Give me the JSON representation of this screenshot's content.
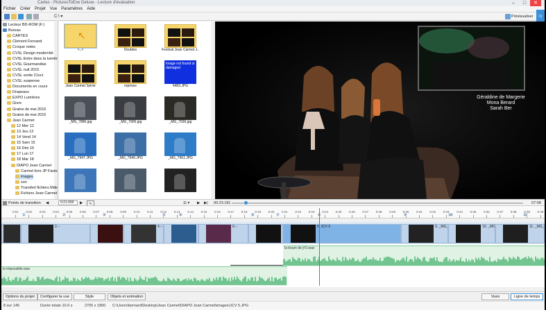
{
  "window": {
    "title": "Cartes - PicturesToExe Deluxe - Lecture d'évaluation"
  },
  "menu": [
    "Fichier",
    "Créer",
    "Projet",
    "Vue",
    "Paramètres",
    "Aide"
  ],
  "toolbar": {
    "drive_label": "C:\\",
    "preview_label": "Prévisualiser"
  },
  "folder_tree": [
    {
      "label": "Lecteur BD-ROM (F:)",
      "icon": "drive-icon",
      "indent": 0
    },
    {
      "label": "Bureau",
      "icon": "desktop-icon",
      "indent": 0
    },
    {
      "label": "CARTES",
      "icon": "folder-icon",
      "indent": 1
    },
    {
      "label": "Clemont Fernand",
      "icon": "folder-icon",
      "indent": 1
    },
    {
      "label": "Croque notes",
      "icon": "folder-icon",
      "indent": 1
    },
    {
      "label": "CVSL Design modernité",
      "icon": "folder-icon",
      "indent": 1
    },
    {
      "label": "CVSL Entre dans la lumière",
      "icon": "folder-icon",
      "indent": 1
    },
    {
      "label": "CVSL Gourmandise",
      "icon": "folder-icon",
      "indent": 1
    },
    {
      "label": "CVSL nuit 2015",
      "icon": "folder-icon",
      "indent": 1
    },
    {
      "label": "CVSL sortie 21oct",
      "icon": "folder-icon",
      "indent": 1
    },
    {
      "label": "CVSL suspense",
      "icon": "folder-icon",
      "indent": 1
    },
    {
      "label": "Documents en cours",
      "icon": "folder-icon",
      "indent": 1
    },
    {
      "label": "Drapeaux",
      "icon": "folder-icon",
      "indent": 1
    },
    {
      "label": "EXPO Lumières",
      "icon": "folder-icon",
      "indent": 1
    },
    {
      "label": "Givre",
      "icon": "folder-icon",
      "indent": 1
    },
    {
      "label": "Graine de mai 2016",
      "icon": "folder-icon",
      "indent": 1
    },
    {
      "label": "Graine de mai 2015",
      "icon": "folder-icon",
      "indent": 1
    },
    {
      "label": "Jean Carmet",
      "icon": "folder-icon",
      "indent": 1
    },
    {
      "label": "12 Mer 12",
      "icon": "folder-icon",
      "indent": 2
    },
    {
      "label": "13 Jeu 13",
      "icon": "folder-icon",
      "indent": 2
    },
    {
      "label": "14 Vend 14",
      "icon": "folder-icon",
      "indent": 2
    },
    {
      "label": "15 Sam 15",
      "icon": "folder-icon",
      "indent": 2
    },
    {
      "label": "16 Dim 16",
      "icon": "folder-icon",
      "indent": 2
    },
    {
      "label": "17 Lun 17",
      "icon": "folder-icon",
      "indent": 2
    },
    {
      "label": "18 Mar 18",
      "icon": "folder-icon",
      "indent": 2
    },
    {
      "label": "DIAPO Jean Carmet",
      "icon": "folder-icon",
      "indent": 2
    },
    {
      "label": "Carmet livre JP Favier",
      "icon": "folder-icon",
      "indent": 3
    },
    {
      "label": "images",
      "icon": "folder-icon",
      "indent": 3,
      "selected": true
    },
    {
      "label": "son",
      "icon": "folder-icon",
      "indent": 3
    },
    {
      "label": "Transfert fichiers Mdef",
      "icon": "folder-icon",
      "indent": 3
    },
    {
      "label": "Fichiers Jean Carmet 2016",
      "icon": "folder-icon",
      "indent": 3
    }
  ],
  "thumbnails": [
    {
      "label": "<..>",
      "kind": "up-folder"
    },
    {
      "label": "Doubles",
      "kind": "folder"
    },
    {
      "label": "Festival Jean Carmet J...",
      "kind": "folder"
    },
    {
      "label": "Jean Carmet Sylvie",
      "kind": "folder"
    },
    {
      "label": "reprises",
      "kind": "folder"
    },
    {
      "label": "6483.JPG",
      "kind": "broken",
      "broken_text": "Image not found or damaged"
    },
    {
      "label": "_MG_7886.jpg",
      "kind": "photo",
      "tint": "#4a4f58"
    },
    {
      "label": "_MG_7905.jpg",
      "kind": "photo",
      "tint": "#3a3d42"
    },
    {
      "label": "_MG_7939.jpg",
      "kind": "photo",
      "tint": "#2c2a24"
    },
    {
      "label": "_MG_7947.JPG",
      "kind": "photo",
      "tint": "#2a6fbf"
    },
    {
      "label": "_MG_7949.JPG",
      "kind": "photo",
      "tint": "#3c6fa6"
    },
    {
      "label": "_MG_7961.JPG",
      "kind": "photo",
      "tint": "#2e7bc7"
    },
    {
      "label": "",
      "kind": "photo",
      "tint": "#3d76b8"
    },
    {
      "label": "",
      "kind": "photo",
      "tint": "#4a5a68"
    },
    {
      "label": "",
      "kind": "photo",
      "tint": "#222"
    }
  ],
  "viewer": {
    "caption": [
      "Géraldine de Margerie",
      "Mona Berard",
      "Sarah Ber"
    ]
  },
  "transport": {
    "transition_points_label": "Points de transition",
    "transition_time": "0:21.000",
    "current_time": "00:23.181",
    "total_time": "07:08"
  },
  "ruler": {
    "ticks": [
      "0:01",
      "0:02",
      "0:03",
      "0:04",
      "0:05",
      "0:06",
      "0:07",
      "0:08",
      "0:09",
      "0:10",
      "0:11",
      "0:12",
      "0:13",
      "0:14",
      "0:15",
      "0:16",
      "0:17",
      "0:18",
      "0:19",
      "0:20",
      "0:21",
      "0:22",
      "0:23",
      "0:24",
      "0:25",
      "0:26",
      "0:27",
      "0:28",
      "0:29",
      "0:30",
      "0:31",
      "0:32",
      "0:33",
      "0:34",
      "0:35",
      "0:36",
      "0:37",
      "0:38",
      "0:39",
      "0:40"
    ],
    "markers": [
      "1",
      "2",
      "3",
      "4",
      "5",
      "6",
      "7",
      "8",
      "9",
      "10",
      "11"
    ]
  },
  "timeline_clips": [
    {
      "label": "1.",
      "color": "#2b2b2b"
    },
    {
      "label": "2.--",
      "color": "#202020"
    },
    {
      "label": "3.--",
      "color": "#3a1010"
    },
    {
      "label": "4.--",
      "color": "#333"
    },
    {
      "label": "5.--",
      "color": "#2d5d8f"
    },
    {
      "label": "6.--",
      "color": "#5a2a4a"
    },
    {
      "label": "7.",
      "color": "#111"
    },
    {
      "label": "8. JCV 5",
      "color": "#111",
      "selected": true
    },
    {
      "label": "9. _MG_",
      "color": "#222"
    },
    {
      "label": "10. _MG_",
      "color": "#1b1b1b"
    },
    {
      "label": "11. _MG_",
      "color": "#1f1f1f"
    }
  ],
  "audio_tracks": [
    {
      "label": "la bourn de jf 0.wav"
    },
    {
      "label": "io impossible.wav"
    }
  ],
  "bottom_buttons": {
    "project_options": "Options du projet",
    "configure_view": "Configurer la vue",
    "style": "Style",
    "objects_animation": "Objets et animation",
    "views_tab": "Vues",
    "timeline_tab": "Ligne de temps"
  },
  "status": {
    "slide_count": "8 sur 146",
    "duration": "Durée totale 10.0 s",
    "resolution": "2705 x 1800",
    "path": "C:\\Users\\bernard\\Desktop\\Jean Carmet\\DIAPO Jean Carmet\\images\\JCV 5.JPG"
  },
  "colors": {
    "accent": "#3b8fd6",
    "folder": "#e6c15c",
    "playhead": "#e34a3c",
    "wave": "#2aa55a",
    "clip": "#bfd3ea"
  }
}
